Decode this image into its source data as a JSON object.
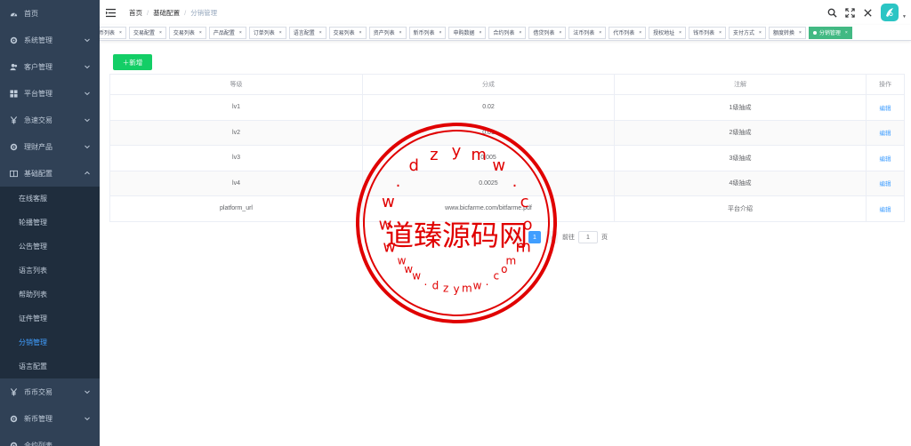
{
  "sidebar": {
    "items": [
      {
        "label": "首页",
        "icon": "dashboard-icon",
        "arrow": false
      },
      {
        "label": "系统管理",
        "icon": "gear-icon",
        "arrow": true
      },
      {
        "label": "客户管理",
        "icon": "users-icon",
        "arrow": true
      },
      {
        "label": "平台管理",
        "icon": "grid-icon",
        "arrow": true
      },
      {
        "label": "急速交易",
        "icon": "yen-icon",
        "arrow": true
      },
      {
        "label": "理财产品",
        "icon": "gear-icon",
        "arrow": true
      },
      {
        "label": "基础配置",
        "icon": "book-icon",
        "arrow": true,
        "expanded": true
      }
    ],
    "sub_items": [
      {
        "label": "在线客服"
      },
      {
        "label": "轮播管理"
      },
      {
        "label": "公告管理"
      },
      {
        "label": "语言列表"
      },
      {
        "label": "帮助列表"
      },
      {
        "label": "证件管理"
      },
      {
        "label": "分销管理",
        "active": true
      },
      {
        "label": "语言配置"
      }
    ],
    "items_after": [
      {
        "label": "币币交易",
        "icon": "yen-icon",
        "arrow": true
      },
      {
        "label": "新币管理",
        "icon": "gear-icon",
        "arrow": true
      },
      {
        "label": "合约列表",
        "icon": "gear-icon",
        "arrow": false
      }
    ]
  },
  "header": {
    "breadcrumb": [
      "首页",
      "基础配置",
      "分销管理"
    ]
  },
  "tags": [
    "币列表",
    "交易配置",
    "交易列表",
    "产品配置",
    "订单列表",
    "语言配置",
    "交易列表",
    "资产列表",
    "新币列表",
    "申购数据",
    "合约列表",
    "借贷列表",
    "法币列表",
    "代币列表",
    "授权地址",
    "钱币列表",
    "支付方式",
    "额度转换",
    "分销管理"
  ],
  "main": {
    "add_label": "＋新增",
    "table": {
      "columns": [
        "等级",
        "分成",
        "注解",
        "操作"
      ],
      "rows": [
        {
          "level": "lv1",
          "share": "0.02",
          "note": "1级抽成",
          "action": "编辑"
        },
        {
          "level": "lv2",
          "share": "0.01",
          "note": "2级抽成",
          "action": "编辑"
        },
        {
          "level": "lv3",
          "share": "0.005",
          "note": "3级抽成",
          "action": "编辑"
        },
        {
          "level": "lv4",
          "share": "0.0025",
          "note": "4级抽成",
          "action": "编辑"
        },
        {
          "level": "platform_url",
          "share": "www.bicfarme.com/bitfarme.pdf",
          "note": "平台介绍",
          "action": "编辑"
        }
      ]
    },
    "pagination": {
      "current_page": "1",
      "goto_prefix": "前往",
      "goto_value": "1",
      "goto_suffix": "页"
    }
  },
  "watermark": {
    "text": "道臻源码网",
    "top_letters": [
      "w",
      "w",
      "w",
      ".",
      "d",
      "z",
      "y",
      "m",
      "w",
      ".",
      "c",
      "o",
      "m"
    ],
    "bottom_letters": [
      "w",
      "w",
      "w",
      ".",
      "d",
      "z",
      "y",
      "m",
      "w",
      ".",
      "c",
      "o",
      "m"
    ],
    "color": "#e00000"
  },
  "colors": {
    "sidebar_bg": "#304156",
    "submenu_bg": "#1f2d3d",
    "active_text": "#409eff",
    "active_tag": "#42b983",
    "add_button": "#13ce66"
  }
}
